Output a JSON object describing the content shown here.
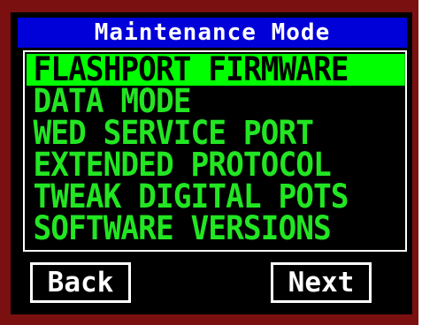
{
  "title": "Maintenance Mode",
  "menu": {
    "items": [
      {
        "label": "FLASHPORT FIRMWARE",
        "selected": true
      },
      {
        "label": "DATA MODE",
        "selected": false
      },
      {
        "label": "WED SERVICE PORT",
        "selected": false
      },
      {
        "label": "EXTENDED PROTOCOL",
        "selected": false
      },
      {
        "label": "TWEAK DIGITAL POTS",
        "selected": false
      },
      {
        "label": "SOFTWARE VERSIONS",
        "selected": false
      }
    ]
  },
  "buttons": {
    "back": "Back",
    "next": "Next"
  },
  "colors": {
    "bezel": "#7a1010",
    "screen": "#000000",
    "title_bar": "#0000d8",
    "menu_text": "#22e622",
    "highlight": "#00ff00"
  }
}
